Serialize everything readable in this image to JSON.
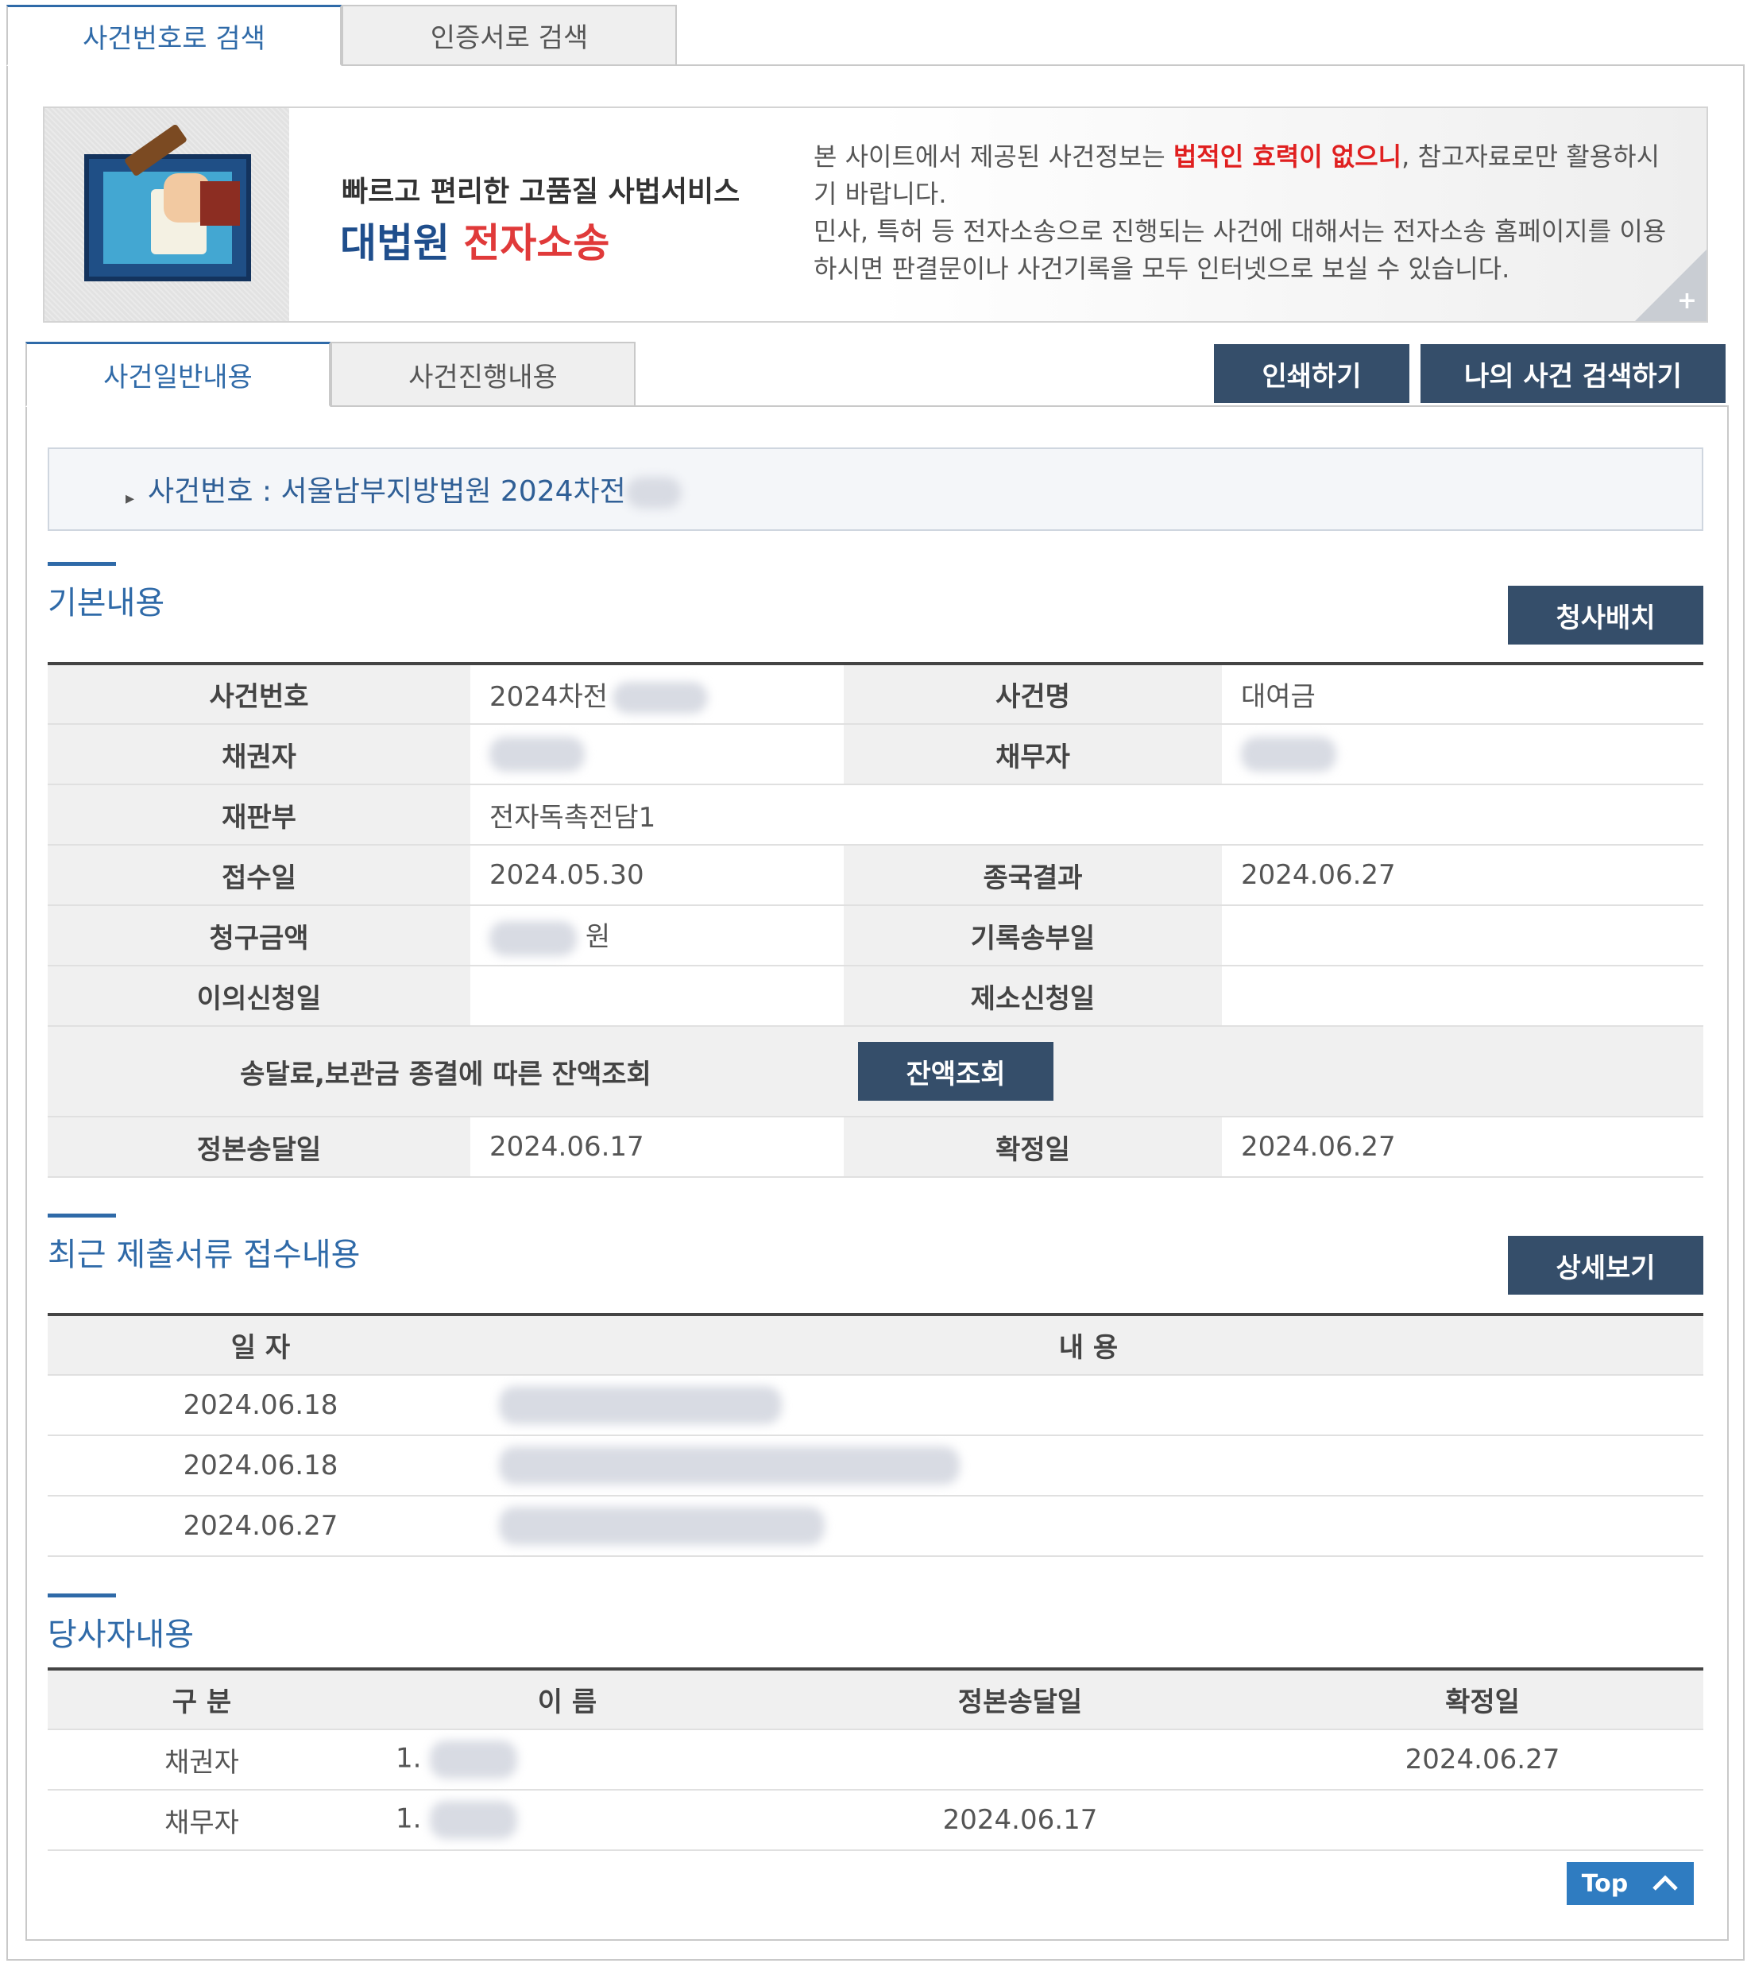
{
  "top_tabs": {
    "tab1": "사건번호로 검색",
    "tab2": "인증서로 검색"
  },
  "banner": {
    "tagline": "빠르고 편리한 고품질 사법서비스",
    "title_main": "대법원",
    "title_accent": "전자소송",
    "desc_part1": "본 사이트에서 제공된 사건정보는 ",
    "desc_warning": "법적인 효력이 없으니",
    "desc_part2": ", 참고자료로만 활용하시기 바랍니다.",
    "desc_line3": "민사, 특허 등 전자소송으로 진행되는 사건에 대해서는 전자소송 홈페이지를 이용하시면 판결문이나 사건기록을 모두 인터넷으로 보실 수 있습니다.",
    "corner_plus": "+"
  },
  "sub_tabs": {
    "tab1": "사건일반내용",
    "tab2": "사건진행내용"
  },
  "buttons": {
    "print": "인쇄하기",
    "my_case_search": "나의 사건 검색하기",
    "building": "청사배치",
    "balance": "잔액조회",
    "detail": "상세보기",
    "top": "Top"
  },
  "case_bar": {
    "text": "사건번호 : 서울남부지방법원 2024차전"
  },
  "basic": {
    "heading": "기본내용",
    "case_no_label": "사건번호",
    "case_no_value": "2024차전",
    "case_name_label": "사건명",
    "case_name_value": "대여금",
    "creditor_label": "채권자",
    "debtor_label": "채무자",
    "court_label": "재판부",
    "court_value": "전자독촉전담1",
    "receipt_label": "접수일",
    "receipt_value": "2024.05.30",
    "final_label": "종국결과",
    "final_value": "2024.06.27",
    "claim_label": "청구금액",
    "claim_unit": "원",
    "record_label": "기록송부일",
    "objection_label": "이의신청일",
    "dismissal_label": "제소신청일",
    "balance_label": "송달료,보관금 종결에 따른 잔액조회",
    "service_label": "정본송달일",
    "service_value": "2024.06.17",
    "confirm_label": "확정일",
    "confirm_value": "2024.06.27"
  },
  "documents": {
    "heading": "최근 제출서류 접수내용",
    "col_date": "일 자",
    "col_content": "내 용",
    "rows": [
      {
        "date": "2024.06.18"
      },
      {
        "date": "2024.06.18"
      },
      {
        "date": "2024.06.27"
      }
    ]
  },
  "parties": {
    "heading": "당사자내용",
    "col_type": "구 분",
    "col_name": "이 름",
    "col_service": "정본송달일",
    "col_confirm": "확정일",
    "rows": [
      {
        "type": "채권자",
        "num": "1.",
        "service": "",
        "confirm": "2024.06.27"
      },
      {
        "type": "채무자",
        "num": "1.",
        "service": "2024.06.17",
        "confirm": ""
      }
    ]
  },
  "colors": {
    "accent": "#2f6aa8",
    "button_dark": "#354e6a",
    "warning": "#e02020",
    "top_button": "#2f7cc1"
  }
}
